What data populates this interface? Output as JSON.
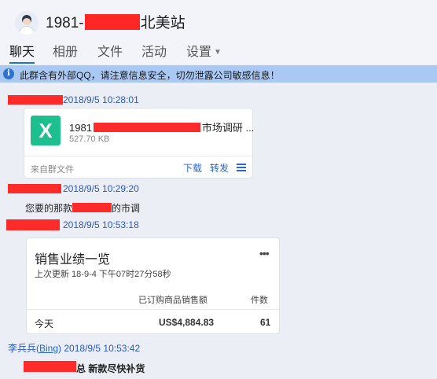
{
  "header": {
    "title_prefix": "1981-",
    "title_suffix": "北美站"
  },
  "tabs": [
    {
      "label": "聊天"
    },
    {
      "label": "相册"
    },
    {
      "label": "文件"
    },
    {
      "label": "活动"
    },
    {
      "label": "设置"
    }
  ],
  "notice": {
    "text": "此群含有外部QQ，请注意信息安全，切勿泄露公司敏感信息！"
  },
  "messages": {
    "m1_time": "2018/9/5 10:28:01",
    "m2_time": "2018/9/5 10:29:20",
    "m2_text_a": "您要的那款",
    "m2_text_b": "的市调",
    "m3_time": "2018/9/5 10:53:18",
    "m4_sender": "李兵兵(",
    "m4_sender_link": "Bing",
    "m4_sender_end": ")",
    "m4_time": "2018/9/5 10:53:42",
    "m4_text": "总  新款尽快补货"
  },
  "file_card": {
    "name_prefix": "1981",
    "name_suffix": "市场调研 ...",
    "size": "527.70 KB",
    "source": "来自群文件",
    "download": "下载",
    "forward": "转发"
  },
  "sales_card": {
    "title": "销售业绩一览",
    "more": "•••",
    "updated": "上次更新 18-9-4 下午07时27分58秒",
    "col_sales": "已订购商品销售额",
    "col_count": "件数",
    "row_label": "今天",
    "row_sales": "US$4,884.83",
    "row_count": "61"
  },
  "colors": {
    "accent": "#1677d8",
    "notice_bg": "#a9c9f4",
    "excel_green": "#1ebf8f",
    "redaction": "#ff2b2b"
  }
}
